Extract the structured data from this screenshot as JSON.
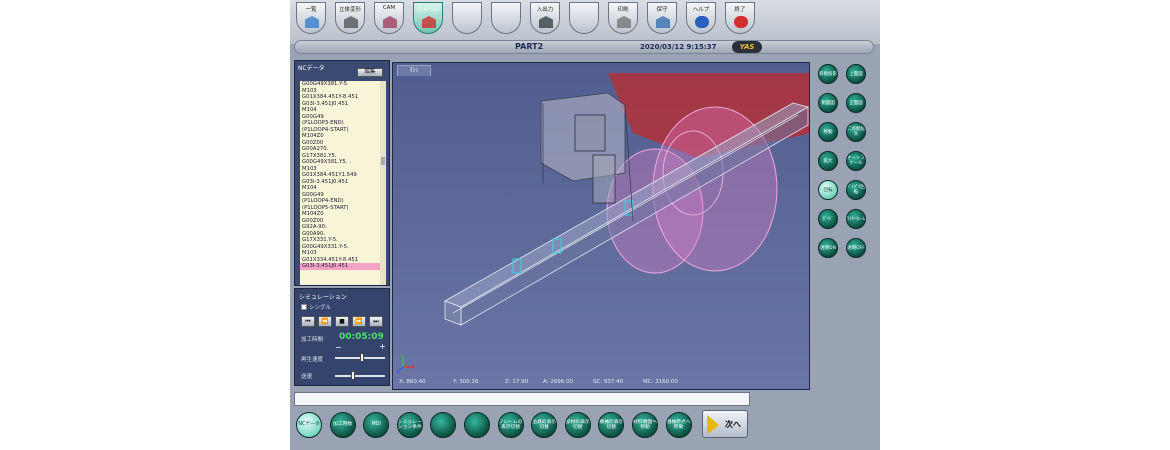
{
  "colors": {
    "accent": "#2fb39a",
    "selected_line": "#f2a3c6",
    "time": "#4fe06a",
    "red_zone": "#c02020",
    "magenta": "#e070c0"
  },
  "toolbar": [
    {
      "label": "一覧",
      "icon": "cube-icon"
    },
    {
      "label": "立体変形",
      "icon": "branch-icon"
    },
    {
      "label": "CAM",
      "icon": "cam-icon"
    },
    {
      "label": "ｼﾐｭﾚｰｼｮﾝ",
      "icon": "simulation-icon",
      "active": true
    },
    {
      "label": "",
      "icon": ""
    },
    {
      "label": "",
      "icon": ""
    },
    {
      "label": "入出力",
      "icon": "io-icon"
    },
    {
      "label": "",
      "icon": ""
    },
    {
      "label": "印刷",
      "icon": "printer-icon"
    },
    {
      "label": "保守",
      "icon": "wrench-icon"
    },
    {
      "label": "ヘルプ",
      "icon": "help-icon"
    },
    {
      "label": "終了",
      "icon": "close-icon"
    }
  ],
  "header": {
    "part": "PART2",
    "datetime": "2020/03/12 9:15:37",
    "logo": "YAS"
  },
  "nc_panel": {
    "title": "NCデータ",
    "edit_label": "編集",
    "lines": [
      "G00G49X381.Y-5.",
      "M103",
      "G01X384.451Y-8.451",
      "G03I-3.451J0.451",
      "M104",
      "G00G49",
      "(P1LOOP3-END)",
      "(P1LOOP4-START)",
      "M104Z0",
      "G00Z00",
      "G00A270.",
      "G17X381.Y5.",
      "G00G49X381.Y5.",
      "M103",
      "G01X384.451Y1.549",
      "G03I-3.451J0.451",
      "M104",
      "G00G49",
      "(P1LOOP4-END)",
      "(P1LOOP5-START)",
      "M104Z0",
      "G00Z00",
      "G92A-90.",
      "G00A90.",
      "G17X331.Y-5.",
      "G00G49X331.Y-5.",
      "M103",
      "G01X334.451Y-8.451",
      "G03I-3.451J0.451"
    ],
    "selected_index": 28
  },
  "sim_panel": {
    "title": "シミュレーション",
    "single_step_label": "シングル",
    "buttons": [
      "⏮",
      "⏪",
      "■",
      "⏩",
      "⏭"
    ],
    "time_label": "加工時間",
    "time_value": "00:05:09",
    "minus": "−",
    "plus": "+",
    "speed_label": "再生速度",
    "feed_label": "送速",
    "speed_level": 0.55,
    "feed_level": 0.35
  },
  "view": {
    "tab": "ﾏｼﾝ",
    "coords": {
      "x": "X: 860.40",
      "y": "Y: 300.16",
      "z": "Z: 17.90",
      "a": "A: 2696.00",
      "sc": "SC: 937.40",
      "mc": "MC: 3160.00"
    }
  },
  "right_buttons": [
    [
      "斜角投影",
      "上面図"
    ],
    [
      "側面図",
      "正面図"
    ],
    [
      "移動",
      "二点間拡大"
    ],
    [
      "拡大",
      "オートスケール"
    ],
    [
      "回転",
      "ﾊﾟｲﾌﾟｾ回転"
    ],
    [
      "ｶﾞｲﾄﾞ",
      "ﾜｲﾔｰﾌﾚｰﾑ"
    ],
    [
      "透明ON",
      "透明OFF"
    ]
  ],
  "right_active": 8,
  "bottom_buttons": [
    "NCデータ",
    "加工時数",
    "MDI",
    "シミュレーション条件",
    "",
    "",
    "フレームの表示切替",
    "治具の表示切替",
    "部材の表示切替",
    "機械の表示切替",
    "材料端面へ移動",
    "機械原点へ移動"
  ],
  "next_label": "次へ"
}
